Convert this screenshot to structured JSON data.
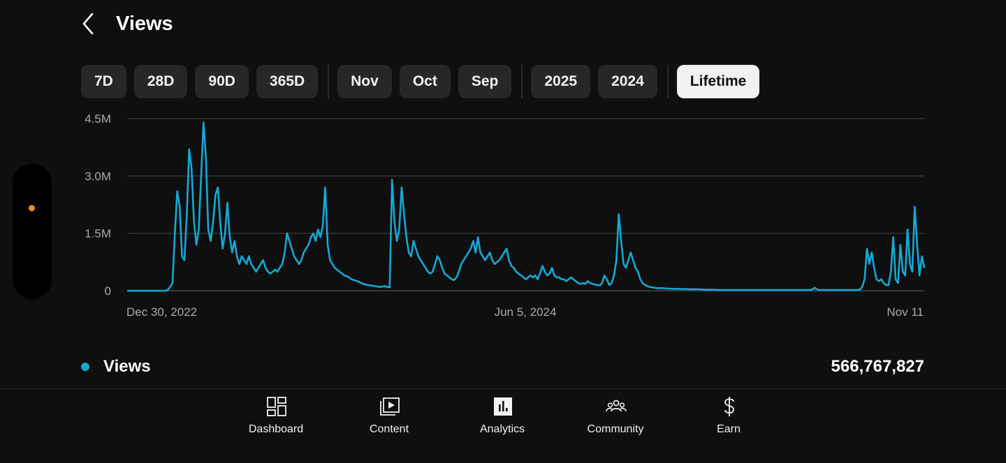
{
  "header": {
    "title": "Views",
    "back_icon": "chevron-left-icon"
  },
  "date_chips": [
    {
      "label": "7D",
      "selected": false
    },
    {
      "label": "28D",
      "selected": false
    },
    {
      "label": "90D",
      "selected": false
    },
    {
      "label": "365D",
      "selected": false
    },
    {
      "label": "Nov",
      "selected": false
    },
    {
      "label": "Oct",
      "selected": false
    },
    {
      "label": "Sep",
      "selected": false
    },
    {
      "label": "2025",
      "selected": false
    },
    {
      "label": "2024",
      "selected": false
    },
    {
      "label": "Lifetime",
      "selected": true
    }
  ],
  "chart_data": {
    "type": "line",
    "title": "",
    "xlabel": "",
    "ylabel": "",
    "ylim": [
      0,
      4500000
    ],
    "y_ticks": [
      {
        "value": 0,
        "label": "0"
      },
      {
        "value": 1500000,
        "label": "1.5M"
      },
      {
        "value": 3000000,
        "label": "3.0M"
      },
      {
        "value": 4500000,
        "label": "4.5M"
      }
    ],
    "x_tick_labels": [
      "Dec 30, 2022",
      "Jun 5, 2024",
      "Nov 11"
    ],
    "grid": true,
    "series": [
      {
        "name": "Views",
        "color": "#16a8d4",
        "values": [
          0,
          0,
          0,
          0,
          0,
          0,
          0,
          0,
          0,
          0,
          0,
          0,
          0,
          0,
          0,
          0,
          0,
          20000,
          100000,
          200000,
          1500000,
          2600000,
          2200000,
          900000,
          800000,
          2000000,
          3700000,
          3200000,
          1800000,
          1200000,
          1600000,
          3000000,
          4400000,
          3500000,
          1600000,
          1300000,
          1800000,
          2500000,
          2700000,
          1800000,
          1100000,
          1500000,
          2300000,
          1400000,
          1000000,
          1300000,
          900000,
          700000,
          900000,
          800000,
          700000,
          900000,
          700000,
          600000,
          500000,
          600000,
          700000,
          800000,
          600000,
          500000,
          450000,
          500000,
          550000,
          500000,
          600000,
          700000,
          1000000,
          1500000,
          1300000,
          1100000,
          900000,
          800000,
          700000,
          800000,
          1000000,
          1100000,
          1200000,
          1400000,
          1500000,
          1300000,
          1600000,
          1400000,
          1700000,
          2700000,
          1200000,
          800000,
          700000,
          600000,
          550000,
          500000,
          450000,
          400000,
          380000,
          350000,
          300000,
          280000,
          260000,
          240000,
          200000,
          180000,
          160000,
          150000,
          140000,
          130000,
          120000,
          110000,
          100000,
          110000,
          120000,
          100000,
          90000,
          2900000,
          1800000,
          1300000,
          1600000,
          2700000,
          2000000,
          1400000,
          1000000,
          900000,
          1300000,
          1100000,
          900000,
          800000,
          700000,
          600000,
          500000,
          450000,
          500000,
          700000,
          900000,
          800000,
          600000,
          450000,
          400000,
          350000,
          300000,
          280000,
          350000,
          500000,
          700000,
          800000,
          900000,
          1000000,
          1100000,
          1300000,
          1000000,
          1400000,
          1000000,
          900000,
          800000,
          900000,
          1000000,
          800000,
          700000,
          750000,
          800000,
          900000,
          1000000,
          1100000,
          800000,
          650000,
          600000,
          500000,
          450000,
          400000,
          350000,
          300000,
          350000,
          400000,
          350000,
          400000,
          300000,
          450000,
          650000,
          500000,
          400000,
          450000,
          600000,
          400000,
          350000,
          350000,
          300000,
          300000,
          250000,
          300000,
          350000,
          300000,
          250000,
          200000,
          180000,
          200000,
          180000,
          250000,
          200000,
          180000,
          160000,
          150000,
          140000,
          200000,
          400000,
          300000,
          150000,
          200000,
          400000,
          800000,
          2000000,
          1300000,
          700000,
          600000,
          800000,
          1000000,
          800000,
          600000,
          500000,
          300000,
          200000,
          150000,
          120000,
          100000,
          90000,
          80000,
          70000,
          70000,
          70000,
          65000,
          60000,
          55000,
          55000,
          50000,
          50000,
          50000,
          45000,
          45000,
          45000,
          45000,
          40000,
          40000,
          40000,
          40000,
          35000,
          35000,
          30000,
          30000,
          30000,
          25000,
          25000,
          25000,
          20000,
          20000,
          20000,
          20000,
          20000,
          20000,
          20000,
          20000,
          20000,
          20000,
          20000,
          20000,
          20000,
          20000,
          20000,
          20000,
          20000,
          20000,
          20000,
          20000,
          20000,
          20000,
          20000,
          20000,
          20000,
          20000,
          20000,
          20000,
          20000,
          20000,
          20000,
          20000,
          20000,
          20000,
          20000,
          20000,
          20000,
          20000,
          20000,
          30000,
          80000,
          40000,
          20000,
          20000,
          20000,
          20000,
          20000,
          20000,
          20000,
          20000,
          20000,
          20000,
          20000,
          20000,
          20000,
          20000,
          20000,
          20000,
          20000,
          30000,
          100000,
          300000,
          1100000,
          700000,
          1000000,
          600000,
          300000,
          250000,
          300000,
          200000,
          150000,
          150000,
          500000,
          1400000,
          300000,
          200000,
          1200000,
          500000,
          400000,
          1600000,
          700000,
          500000,
          2200000,
          1200000,
          400000,
          900000,
          600000
        ]
      }
    ]
  },
  "legend": {
    "label": "Views",
    "total": "566,767,827",
    "dot_color": "#16a8d4"
  },
  "bottom_nav": [
    {
      "label": "Dashboard",
      "icon": "dashboard-icon"
    },
    {
      "label": "Content",
      "icon": "content-icon"
    },
    {
      "label": "Analytics",
      "icon": "analytics-icon",
      "selected": true
    },
    {
      "label": "Community",
      "icon": "community-icon"
    },
    {
      "label": "Earn",
      "icon": "dollar-icon"
    }
  ]
}
